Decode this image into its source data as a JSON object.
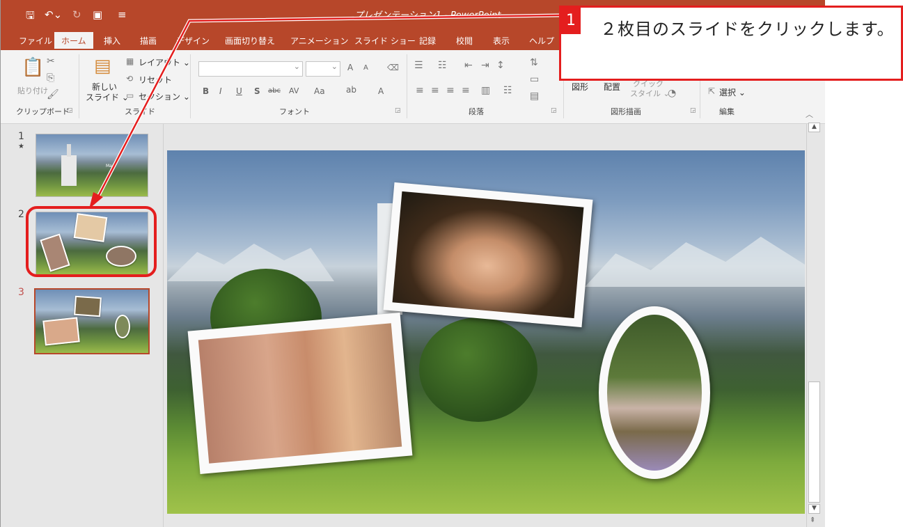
{
  "window": {
    "title": "プレゼンテーション1 - PowerPoint"
  },
  "qat": {
    "save_icon": "save-icon",
    "undo_icon": "undo-icon",
    "redo_icon": "redo-icon",
    "present_icon": "present-from-start-icon",
    "customize_icon": "customize-qat-icon"
  },
  "tabs": [
    {
      "label": "ファイル"
    },
    {
      "label": "ホーム"
    },
    {
      "label": "挿入"
    },
    {
      "label": "描画"
    },
    {
      "label": "デザイン"
    },
    {
      "label": "画面切り替え"
    },
    {
      "label": "アニメーション"
    },
    {
      "label": "スライド ショー"
    },
    {
      "label": "記録"
    },
    {
      "label": "校閲"
    },
    {
      "label": "表示"
    },
    {
      "label": "ヘルプ"
    }
  ],
  "ribbon": {
    "clipboard": {
      "paste": "貼り付け",
      "group": "クリップボード"
    },
    "slides": {
      "new_slide_line1": "新しい",
      "new_slide_line2": "スライド ⌄",
      "layout": "レイアウト ⌄",
      "reset": "リセット",
      "section": "セクション ⌄",
      "group": "スライド"
    },
    "font": {
      "bold": "B",
      "italic": "I",
      "underline": "U",
      "shadow": "S",
      "strike": "abc",
      "spacing": "AV",
      "case": "Aa",
      "grow": "A",
      "shrink": "A",
      "color": "A",
      "group": "フォント"
    },
    "paragraph": {
      "group": "段落"
    },
    "drawing": {
      "shapes": "図形",
      "arrange": "配置",
      "quick_styles_line1": "クイック",
      "quick_styles_line2": "スタイル ⌄",
      "group": "図形描画"
    },
    "editing": {
      "select": "選択 ⌄",
      "group": "編集"
    }
  },
  "thumbnails": [
    {
      "number": "1",
      "marker": "★",
      "caption": "Mary"
    },
    {
      "number": "2",
      "marker": ""
    },
    {
      "number": "3",
      "marker": ""
    }
  ],
  "callout": {
    "number": "1",
    "text": "２枚目のスライドをクリックします。"
  },
  "colors": {
    "accent": "#b7472a",
    "callout": "#e41e1e"
  }
}
